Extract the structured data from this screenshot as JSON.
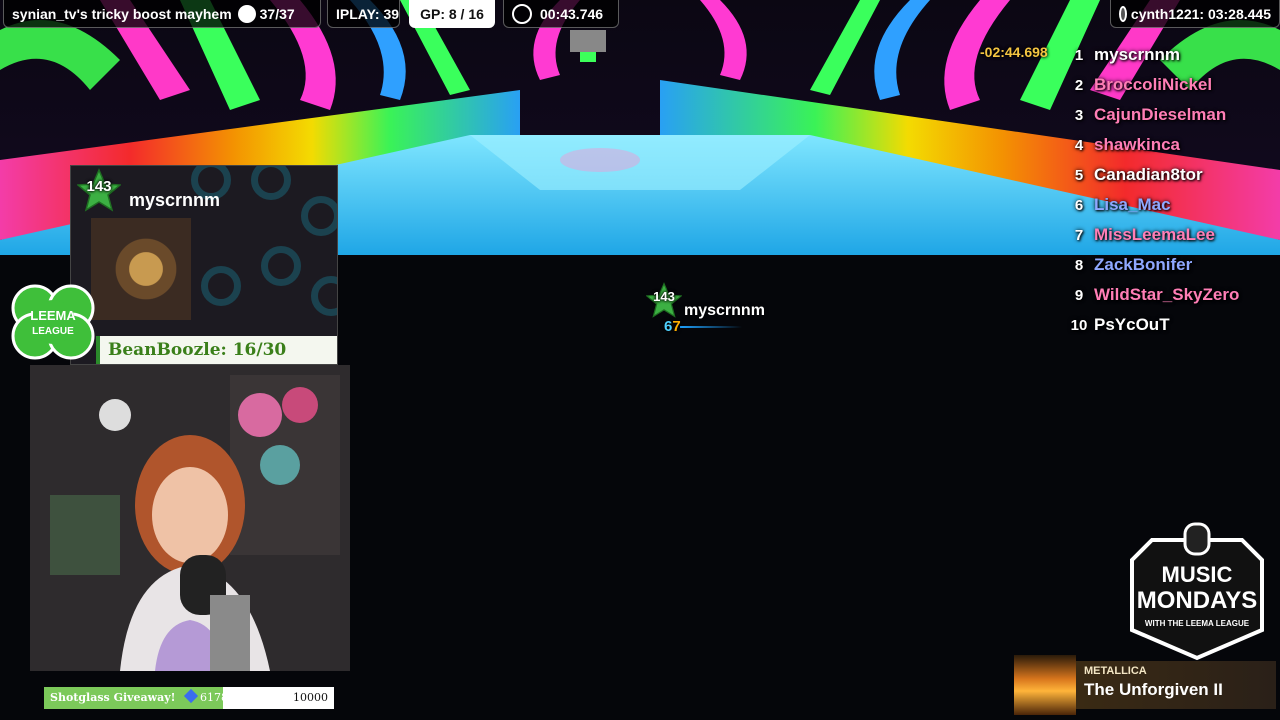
{
  "top_bar": {
    "stream_title": "synian_tv's tricky boost mayhem",
    "count": "37/37",
    "iplay": "IPLAY: 39",
    "gp": "GP: 8 / 16",
    "timer": "00:43.746",
    "record": "cynth1221: 03:28.445"
  },
  "leaderboard": {
    "delta": "-02:44.698",
    "rows": [
      {
        "rank": "1",
        "name": "myscrnnm",
        "color": "#ffffff"
      },
      {
        "rank": "2",
        "name": "BroccoliNickel",
        "color": "#ff7eb6"
      },
      {
        "rank": "3",
        "name": "CajunDieselman",
        "color": "#ff7eb6"
      },
      {
        "rank": "4",
        "name": "shawkinca",
        "color": "#ff7eb6"
      },
      {
        "rank": "5",
        "name": "Canadian8tor",
        "color": "#ffffff"
      },
      {
        "rank": "6",
        "name": "Lisa_Mac",
        "color": "#8fa8ff"
      },
      {
        "rank": "7",
        "name": "MissLeemaLee",
        "color": "#ff7eb6"
      },
      {
        "rank": "8",
        "name": "ZackBonifer",
        "color": "#8fa8ff"
      },
      {
        "rank": "9",
        "name": "WildStar_SkyZero",
        "color": "#ff7eb6"
      },
      {
        "rank": "10",
        "name": "PsYcOuT",
        "color": "#ffffff"
      }
    ]
  },
  "profile_card": {
    "level": "143",
    "username": "myscrnnm",
    "bean_boozle": "BeanBoozle: 16/30"
  },
  "clover_logo": {
    "text": "LEEMA LEAGUE"
  },
  "player_tag": {
    "level": "143",
    "name": "myscrnnm",
    "number_blue": "6",
    "number_orange": "7"
  },
  "giveaway": {
    "label": "Shotglass Giveaway!",
    "current": "6178",
    "goal": "10000",
    "progress": 0.6178
  },
  "music_mondays": {
    "line1": "MUSIC",
    "line2": "MONDAYS",
    "line3": "WITH THE LEEMA LEAGUE"
  },
  "now_playing": {
    "artist": "METALLICA",
    "title": "The Unforgiven II"
  },
  "colors": {
    "accent_green": "#3cb043",
    "gold": "#f5c542"
  }
}
